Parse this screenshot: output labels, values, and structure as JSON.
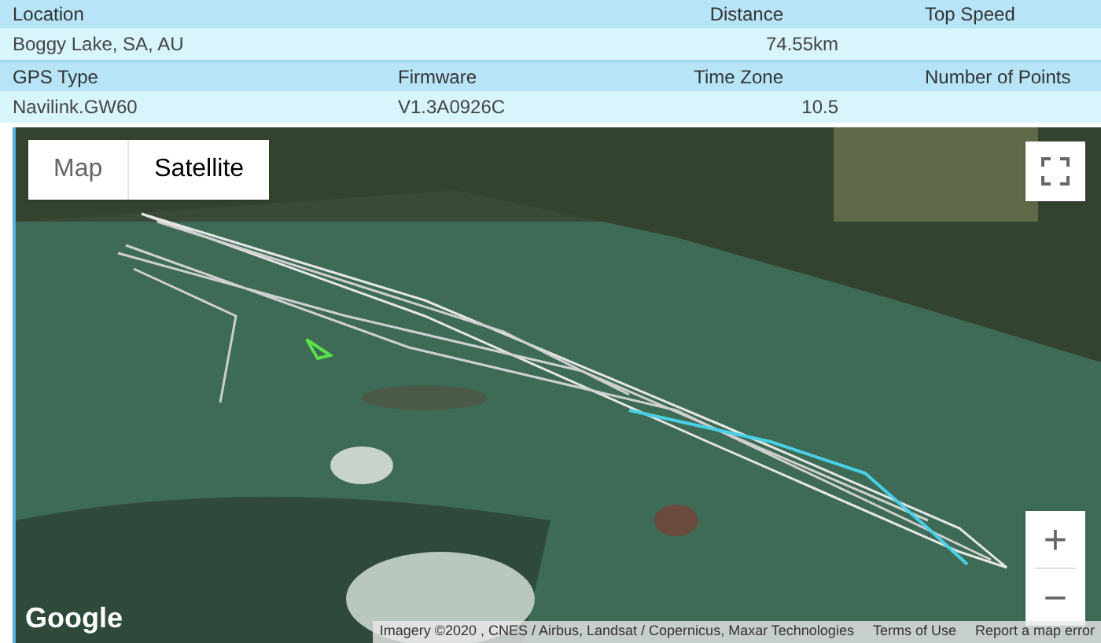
{
  "info_table": [
    {
      "headers": {
        "column_1": "Location",
        "column_3": "Distance",
        "column_4": "Top Speed"
      },
      "values": {
        "column_1": "Boggy Lake, SA, AU",
        "column_3": "74.55km"
      }
    },
    {
      "headers": {
        "column_1": "GPS Type",
        "column_2": "Firmware",
        "column_3": "Time Zone",
        "column_4": "Number of Points"
      },
      "values": {
        "column_1": "Navilink.GW60",
        "column_2": "V1.3A0926C",
        "column_3": "10.5"
      }
    }
  ],
  "map": {
    "type_tabs": [
      {
        "label": "Map",
        "selected": false
      },
      {
        "label": "Satellite",
        "selected": true
      }
    ],
    "zoom_in": "+",
    "zoom_out": "−",
    "logo": "Google",
    "attribution": [
      "Imagery ©2020 , CNES / Airbus, Landsat / Copernicus, Maxar Technologies",
      "Terms of Use",
      "Report a map error"
    ]
  }
}
